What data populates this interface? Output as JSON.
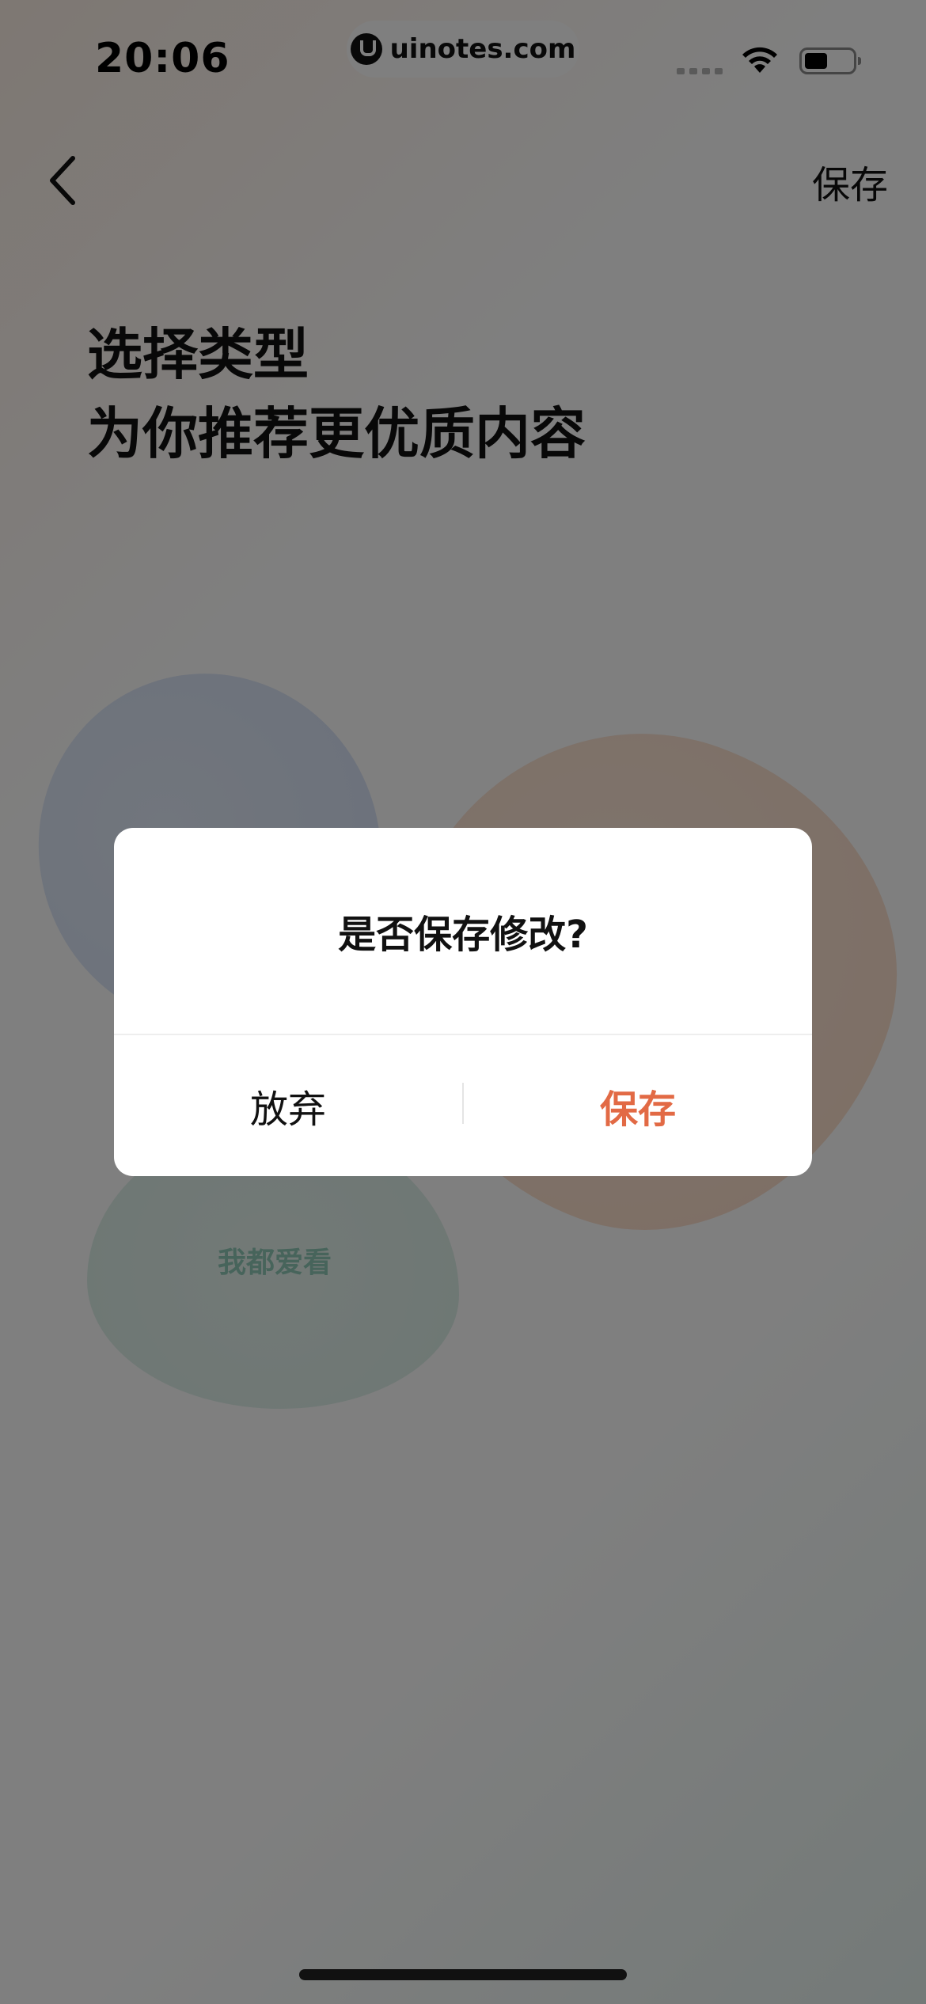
{
  "status_bar": {
    "time": "20:06",
    "watermark": "uinotes.com",
    "wifi_icon": "wifi-icon",
    "battery_icon": "battery-icon"
  },
  "nav": {
    "back_icon": "chevron-left-icon",
    "save_label": "保存"
  },
  "headline": {
    "line1": "选择类型",
    "line2": "为你推荐更优质内容"
  },
  "background_option": {
    "label": "我都爱看"
  },
  "dialog": {
    "title": "是否保存修改?",
    "discard_label": "放弃",
    "save_label": "保存",
    "save_color": "#e26a45"
  },
  "colors": {
    "overlay": "rgba(0,0,0,0.5)",
    "accent": "#e26a45"
  }
}
